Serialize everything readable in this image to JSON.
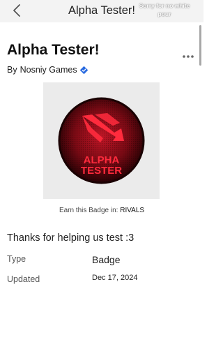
{
  "header": {
    "title": "Alpha Tester!",
    "overlay_text": "Sorry for no white pour"
  },
  "badge": {
    "name": "Alpha Tester!",
    "by_label": "By",
    "creator": "Nosniy Games",
    "image_text_line1": "ALPHA",
    "image_text_line2": "TESTER",
    "earn_label": "Earn this Badge in:",
    "game_name": "RIVALS",
    "description": "Thanks for helping us test :3",
    "type_label": "Type",
    "type_value": "Badge",
    "updated_label": "Updated",
    "updated_value": "Dec 17, 2024"
  },
  "icons": [
    "back-arrow-icon",
    "more-options-icon",
    "verified-badge-icon"
  ],
  "colors": {
    "header_bg": "#f3f3f3",
    "badge_red": "#d61a2c",
    "badge_dark": "#3a0509",
    "verified_blue": "#2a6be0"
  }
}
